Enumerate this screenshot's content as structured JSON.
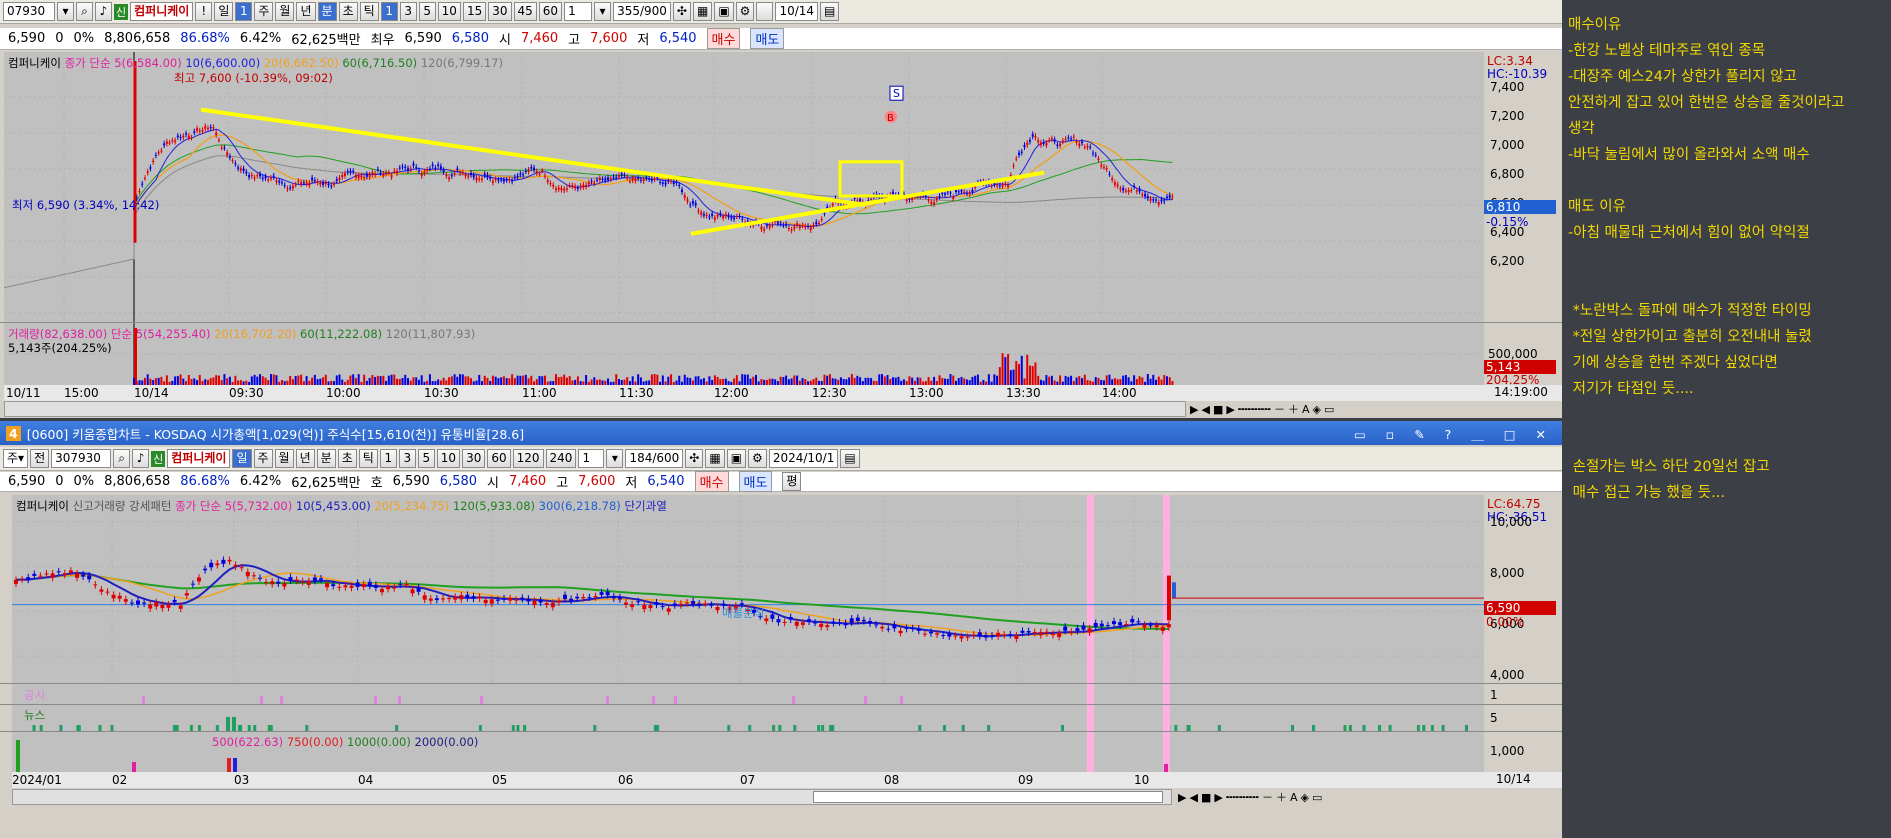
{
  "top": {
    "toolbar": {
      "code": "07930",
      "stock": "컴퍼니케이",
      "period_buttons": [
        "!",
        "일",
        "1",
        "주",
        "월",
        "년",
        "분",
        "초",
        "틱"
      ],
      "minute_buttons": [
        "1",
        "3",
        "5",
        "10",
        "15",
        "30",
        "45",
        "60"
      ],
      "step": "1",
      "count": "355/900",
      "date": "10/14"
    },
    "quote": {
      "price": "6,590",
      "change": "0",
      "pct": "0%",
      "volume": "8,806,658",
      "ratio": "86.68%",
      "turnover": "6.42%",
      "amount": "62,625백만",
      "bid_label": "최우",
      "bid1": "6,590",
      "bid2": "6,580",
      "open_label": "시",
      "open": "7,460",
      "high_label": "고",
      "high": "7,600",
      "low_label": "저",
      "low": "6,540",
      "buy": "매수",
      "sell": "매도"
    },
    "legend": {
      "name": "컴퍼니케이",
      "ma5": "종가 단순 5(6,584.00)",
      "ma10": "10(6,600.00)",
      "ma20": "20(6,662.50)",
      "ma60": "60(6,716.50)",
      "ma120": "120(6,799.17)"
    },
    "annot_high": "최고 7,600 (-10.39%, 09:02)",
    "annot_low": "최저 6,590 (3.34%, 14:42)",
    "lc": "LC:3.34",
    "hc": "HC:-10.39",
    "price_ticks": [
      "7,400",
      "7,200",
      "7,000",
      "6,800",
      "6,600",
      "6,400",
      "6,200"
    ],
    "cur_price": "6,810",
    "cur_pct": "-0.15%",
    "vol_legend": {
      "v": "거래량(82,638.00)",
      "ma5": "단순 5(54,255.40)",
      "ma20": "20(16,702.20)",
      "ma60": "60(11,222.08)",
      "ma120": "120(11,807.93)",
      "sub": "5,143주(204.25%)"
    },
    "vol_ticks": [
      "500,000"
    ],
    "vol_cur": "5,143",
    "vol_pct": "204.25%",
    "time_ticks": [
      "10/11",
      "15:00",
      "10/14",
      "09:30",
      "10:00",
      "10:30",
      "11:00",
      "11:30",
      "12:00",
      "12:30",
      "13:00",
      "13:30",
      "14:00"
    ],
    "time_end": "14:19:00",
    "markers": {
      "s": "S",
      "b": "B"
    },
    "colors": {
      "up": "#e00000",
      "down": "#0000e0",
      "trend": "#ffff00",
      "ma5": "#2020e0",
      "ma20": "#f0a020",
      "ma60": "#20a020",
      "ma120": "#888888"
    }
  },
  "bottom": {
    "title_num": "4",
    "title": "[0600] 키움종합차트 - KOSDAQ 시가총액[1,029(억)] 주식수[15,610(천)] 유통비율[28.6]",
    "toolbar": {
      "code": "307930",
      "stock": "컴퍼니케이",
      "period_buttons": [
        "일",
        "주",
        "월",
        "년",
        "분",
        "초",
        "틱"
      ],
      "minute_buttons": [
        "1",
        "3",
        "5",
        "10",
        "30",
        "60",
        "120",
        "240"
      ],
      "step": "1",
      "count": "184/600",
      "date": "2024/10/1"
    },
    "quote": {
      "price": "6,590",
      "change": "0",
      "pct": "0%",
      "volume": "8,806,658",
      "ratio": "86.68%",
      "turnover": "6.42%",
      "amount": "62,625백만",
      "bid_label": "호",
      "bid1": "6,590",
      "bid2": "6,580",
      "open_label": "시",
      "open": "7,460",
      "high_label": "고",
      "high": "7,600",
      "low_label": "저",
      "low": "6,540",
      "buy": "매수",
      "sell": "매도",
      "flat": "평"
    },
    "legend": {
      "name": "컴퍼니케이",
      "pattern": "신고거래량 강세패턴",
      "ma5": "종가 단순 5(5,732.00)",
      "ma10": "10(5,453.00)",
      "ma20": "20(5,234.75)",
      "ma120": "120(5,933.08)",
      "ma300": "300(6,218.78)",
      "hot": "단기과열"
    },
    "lc": "LC:64.75",
    "hc": "HC:-36.51",
    "price_ticks": [
      "10,000",
      "8,000",
      "6,000",
      "4,000"
    ],
    "cur_price": "6,590",
    "cur_pct": "0.00%",
    "sub1_label": "공시",
    "sub1_tick": "1",
    "sub2_label": "뉴스",
    "sub2_tick": "5",
    "sub3_legend": {
      "a": "500(622.63)",
      "b": "750(0.00)",
      "c": "1000(0.00)",
      "d": "2000(0.00)"
    },
    "sub3_tick": "1,000",
    "date_ticks": [
      "2024/01",
      "02",
      "03",
      "04",
      "05",
      "06",
      "07",
      "08",
      "09",
      "10"
    ],
    "date_end": "10/14",
    "mid_label": "매물분석"
  },
  "note": {
    "lines": [
      "매수이유",
      "-한강 노벨상 테마주로 엮인 종목",
      "-대장주 예스24가 상한가 풀리지 않고",
      "안전하게 잡고 있어 한번은 상승을 줄것이라고",
      "생각",
      "-바닥 눌림에서 많이 올라와서 소액 매수",
      "",
      "매도 이유",
      "-아침 매물대 근처에서 힘이 없어 약익절",
      "",
      "",
      " *노란박스 돌파에 매수가 적정한 타이밍",
      " *전일 상한가이고 출분히 오전내내 눌렸",
      " 기에 상승을 한번 주겠다 싶었다면",
      " 저기가 타점인 듯....",
      "",
      "",
      " 손절가는 박스 하단 20일선 잡고",
      " 매수 접근 가능 했을 듯..."
    ]
  }
}
